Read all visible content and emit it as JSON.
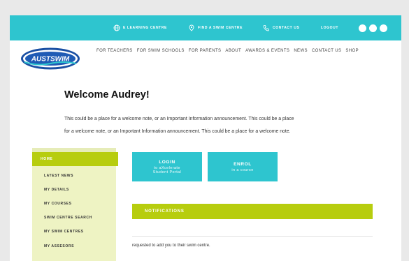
{
  "topbar": {
    "elearning": "E LEARNING CENTRE",
    "find_swim": "FIND A SWIM CENTRE",
    "contact": "CONTACT US",
    "logout": "LOGOUT"
  },
  "logo": {
    "text": "AUSTSWIM"
  },
  "nav": [
    "FOR TEACHERS",
    "FOR SWIM SCHOOLS",
    "FOR PARENTS",
    "ABOUT",
    "AWARDS & EVENTS",
    "NEWS",
    "CONTACT US",
    "SHOP"
  ],
  "welcome": {
    "title": "Welcome Audrey!",
    "line1": "This could be a place for a welcome note, or an Important Information announcement. This could be a place",
    "line2": "for a welcome note, or an Important Information announcement. This could be a place for a welcome note."
  },
  "sidebar": {
    "home": "HOME",
    "items": [
      "LATEST NEWS",
      "MY DETAILS",
      "MY COURSES",
      "SWIM CENTRE SEARCH",
      "MY SWIM CENTRES",
      "MY ASSESORS"
    ]
  },
  "buttons": {
    "login_main": "LOGIN",
    "login_sub1": "to aXcelerate",
    "login_sub2": "Student Portal",
    "enrol_main": "ENROL",
    "enrol_sub": "in a course"
  },
  "notifications": {
    "title": "NOTIFICATIONS",
    "text": "requested to add you to their swim centre."
  },
  "colors": {
    "teal": "#2ec5cf",
    "lime": "#b7cd0e",
    "sidebar_bg": "#eef3c3"
  }
}
